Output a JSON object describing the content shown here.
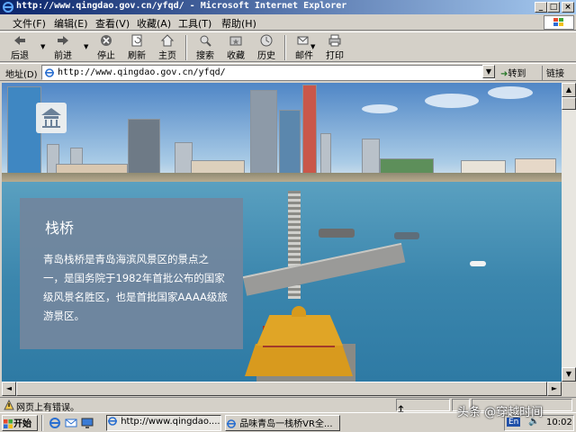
{
  "window": {
    "title": "http://www.qingdao.gov.cn/yfqd/ - Microsoft Internet Explorer",
    "controls": {
      "minimize": "_",
      "maximize": "□",
      "close": "×"
    }
  },
  "menubar": {
    "items": [
      "文件(F)",
      "编辑(E)",
      "查看(V)",
      "收藏(A)",
      "工具(T)",
      "帮助(H)"
    ]
  },
  "toolbar": {
    "back_label": "后退",
    "forward_label": "前进",
    "stop_label": "停止",
    "refresh_label": "刷新",
    "home_label": "主页",
    "search_label": "搜索",
    "favorites_label": "收藏",
    "history_label": "历史",
    "mail_label": "邮件",
    "print_label": "打印"
  },
  "addressbar": {
    "label": "地址(D)",
    "url": "http://www.qingdao.gov.cn/yfqd/",
    "go_label": "转到",
    "links_label": "链接"
  },
  "page": {
    "title": "栈桥",
    "description": "青岛栈桥是青岛海滨风景区的景点之一，是国务院于1982年首批公布的国家级风景名胜区，也是首批国家AAAA级旅游景区。"
  },
  "statusbar": {
    "text": "网页上有错误。"
  },
  "taskbar": {
    "start_label": "开始",
    "tasks": [
      "http://www.qingdao....",
      "品味青岛一栈桥VR全..."
    ],
    "tray_lang": "En",
    "clock": "10:02"
  },
  "watermark": "头条 @穿越时间",
  "colors": {
    "titlebar_start": "#0a246a",
    "titlebar_end": "#a6caf0",
    "chrome": "#d4d0c8",
    "overlay": "#70869e"
  }
}
